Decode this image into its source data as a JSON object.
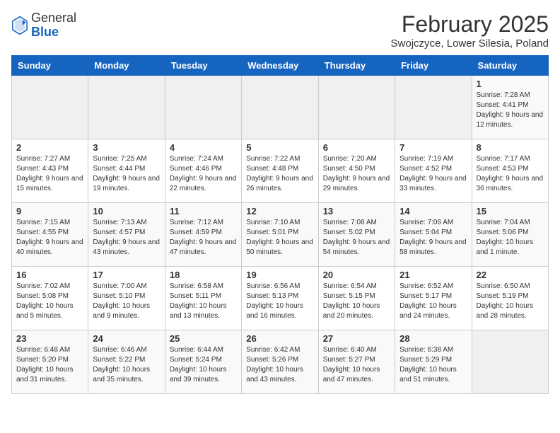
{
  "header": {
    "logo_general": "General",
    "logo_blue": "Blue",
    "month_title": "February 2025",
    "subtitle": "Swojczyce, Lower Silesia, Poland"
  },
  "weekdays": [
    "Sunday",
    "Monday",
    "Tuesday",
    "Wednesday",
    "Thursday",
    "Friday",
    "Saturday"
  ],
  "weeks": [
    [
      {
        "day": "",
        "info": ""
      },
      {
        "day": "",
        "info": ""
      },
      {
        "day": "",
        "info": ""
      },
      {
        "day": "",
        "info": ""
      },
      {
        "day": "",
        "info": ""
      },
      {
        "day": "",
        "info": ""
      },
      {
        "day": "1",
        "info": "Sunrise: 7:28 AM\nSunset: 4:41 PM\nDaylight: 9 hours and 12 minutes."
      }
    ],
    [
      {
        "day": "2",
        "info": "Sunrise: 7:27 AM\nSunset: 4:43 PM\nDaylight: 9 hours and 15 minutes."
      },
      {
        "day": "3",
        "info": "Sunrise: 7:25 AM\nSunset: 4:44 PM\nDaylight: 9 hours and 19 minutes."
      },
      {
        "day": "4",
        "info": "Sunrise: 7:24 AM\nSunset: 4:46 PM\nDaylight: 9 hours and 22 minutes."
      },
      {
        "day": "5",
        "info": "Sunrise: 7:22 AM\nSunset: 4:48 PM\nDaylight: 9 hours and 26 minutes."
      },
      {
        "day": "6",
        "info": "Sunrise: 7:20 AM\nSunset: 4:50 PM\nDaylight: 9 hours and 29 minutes."
      },
      {
        "day": "7",
        "info": "Sunrise: 7:19 AM\nSunset: 4:52 PM\nDaylight: 9 hours and 33 minutes."
      },
      {
        "day": "8",
        "info": "Sunrise: 7:17 AM\nSunset: 4:53 PM\nDaylight: 9 hours and 36 minutes."
      }
    ],
    [
      {
        "day": "9",
        "info": "Sunrise: 7:15 AM\nSunset: 4:55 PM\nDaylight: 9 hours and 40 minutes."
      },
      {
        "day": "10",
        "info": "Sunrise: 7:13 AM\nSunset: 4:57 PM\nDaylight: 9 hours and 43 minutes."
      },
      {
        "day": "11",
        "info": "Sunrise: 7:12 AM\nSunset: 4:59 PM\nDaylight: 9 hours and 47 minutes."
      },
      {
        "day": "12",
        "info": "Sunrise: 7:10 AM\nSunset: 5:01 PM\nDaylight: 9 hours and 50 minutes."
      },
      {
        "day": "13",
        "info": "Sunrise: 7:08 AM\nSunset: 5:02 PM\nDaylight: 9 hours and 54 minutes."
      },
      {
        "day": "14",
        "info": "Sunrise: 7:06 AM\nSunset: 5:04 PM\nDaylight: 9 hours and 58 minutes."
      },
      {
        "day": "15",
        "info": "Sunrise: 7:04 AM\nSunset: 5:06 PM\nDaylight: 10 hours and 1 minute."
      }
    ],
    [
      {
        "day": "16",
        "info": "Sunrise: 7:02 AM\nSunset: 5:08 PM\nDaylight: 10 hours and 5 minutes."
      },
      {
        "day": "17",
        "info": "Sunrise: 7:00 AM\nSunset: 5:10 PM\nDaylight: 10 hours and 9 minutes."
      },
      {
        "day": "18",
        "info": "Sunrise: 6:58 AM\nSunset: 5:11 PM\nDaylight: 10 hours and 13 minutes."
      },
      {
        "day": "19",
        "info": "Sunrise: 6:56 AM\nSunset: 5:13 PM\nDaylight: 10 hours and 16 minutes."
      },
      {
        "day": "20",
        "info": "Sunrise: 6:54 AM\nSunset: 5:15 PM\nDaylight: 10 hours and 20 minutes."
      },
      {
        "day": "21",
        "info": "Sunrise: 6:52 AM\nSunset: 5:17 PM\nDaylight: 10 hours and 24 minutes."
      },
      {
        "day": "22",
        "info": "Sunrise: 6:50 AM\nSunset: 5:19 PM\nDaylight: 10 hours and 28 minutes."
      }
    ],
    [
      {
        "day": "23",
        "info": "Sunrise: 6:48 AM\nSunset: 5:20 PM\nDaylight: 10 hours and 31 minutes."
      },
      {
        "day": "24",
        "info": "Sunrise: 6:46 AM\nSunset: 5:22 PM\nDaylight: 10 hours and 35 minutes."
      },
      {
        "day": "25",
        "info": "Sunrise: 6:44 AM\nSunset: 5:24 PM\nDaylight: 10 hours and 39 minutes."
      },
      {
        "day": "26",
        "info": "Sunrise: 6:42 AM\nSunset: 5:26 PM\nDaylight: 10 hours and 43 minutes."
      },
      {
        "day": "27",
        "info": "Sunrise: 6:40 AM\nSunset: 5:27 PM\nDaylight: 10 hours and 47 minutes."
      },
      {
        "day": "28",
        "info": "Sunrise: 6:38 AM\nSunset: 5:29 PM\nDaylight: 10 hours and 51 minutes."
      },
      {
        "day": "",
        "info": ""
      }
    ]
  ]
}
